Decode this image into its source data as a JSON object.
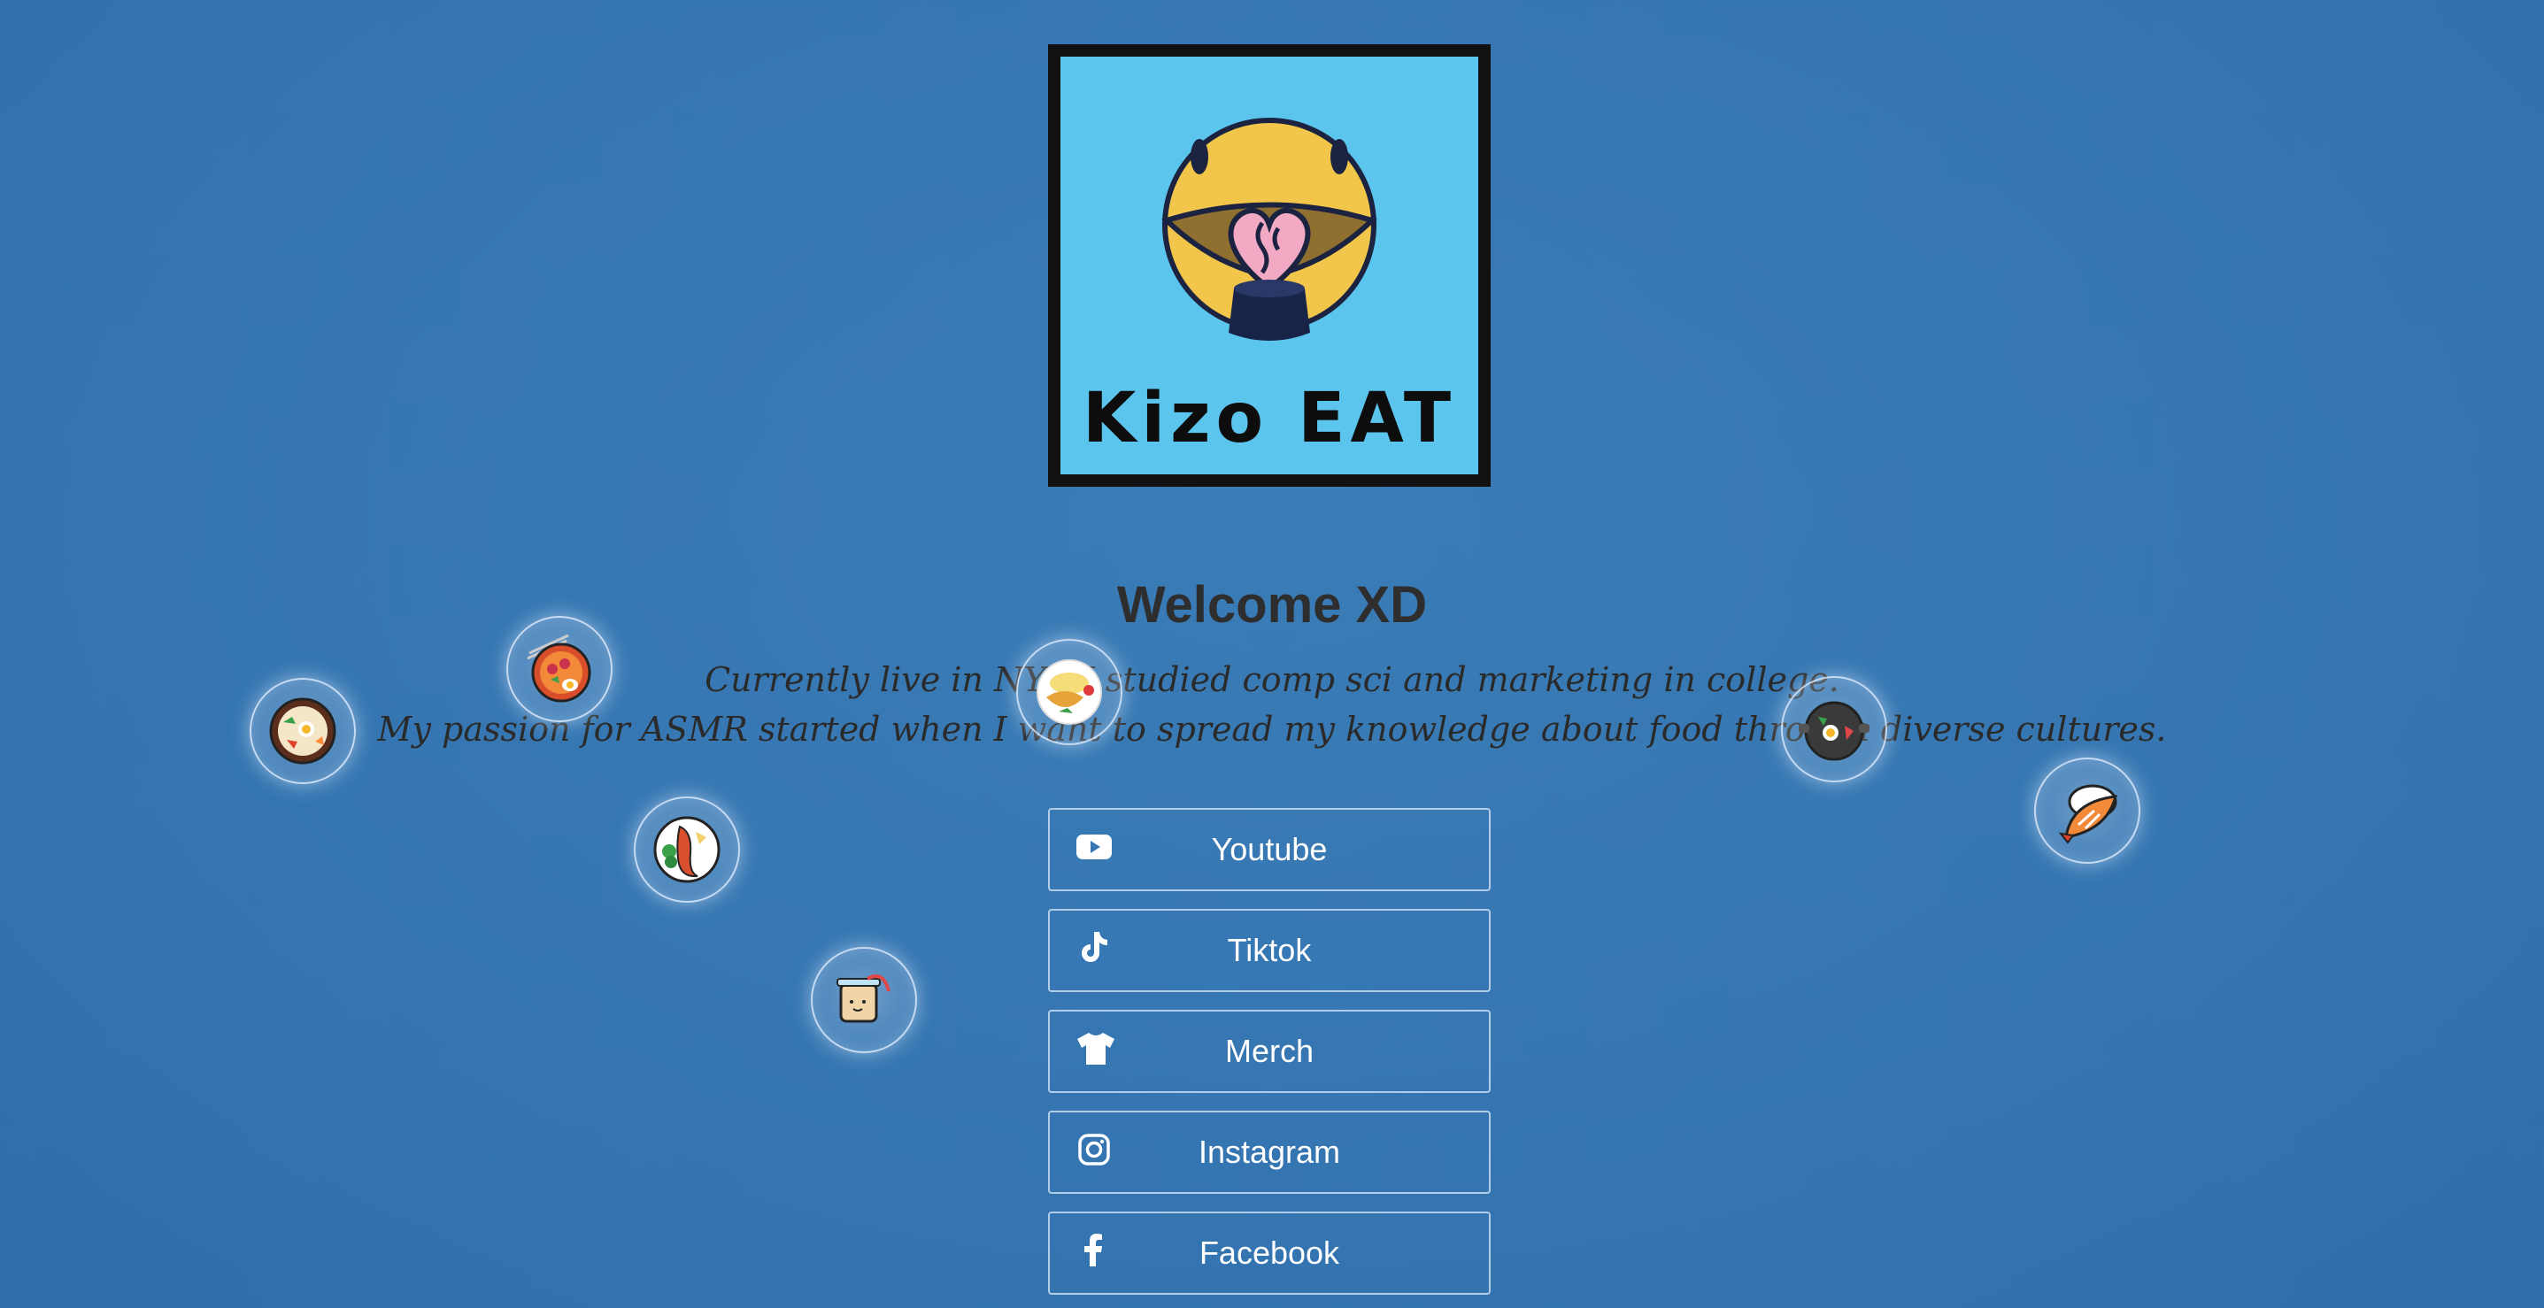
{
  "logo": {
    "text": "Kizo EAT",
    "background": "#5bc5ee",
    "border": "#111111"
  },
  "header": {
    "title": "Welcome XD"
  },
  "bio": {
    "line1": "Currently live in NYC I studied comp sci and marketing in college.",
    "line2": "My passion for ASMR started when I want to spread my knowledge about food through diverse cultures."
  },
  "links": [
    {
      "label": "Youtube",
      "icon": "youtube-icon"
    },
    {
      "label": "Tiktok",
      "icon": "tiktok-icon"
    },
    {
      "label": "Merch",
      "icon": "tshirt-icon"
    },
    {
      "label": "Instagram",
      "icon": "instagram-icon"
    },
    {
      "label": "Facebook",
      "icon": "facebook-icon"
    }
  ],
  "bubbles": [
    {
      "icon": "bibimbap-icon"
    },
    {
      "icon": "ramen-icon"
    },
    {
      "icon": "lobster-plate-icon"
    },
    {
      "icon": "bubble-tea-icon"
    },
    {
      "icon": "fried-fish-plate-icon"
    },
    {
      "icon": "hot-pot-icon"
    },
    {
      "icon": "shrimp-sushi-icon"
    }
  ],
  "colors": {
    "background": "#3576b2",
    "title_text": "#2e2e2e",
    "button_border": "#dcebfa",
    "button_text": "#ffffff"
  }
}
